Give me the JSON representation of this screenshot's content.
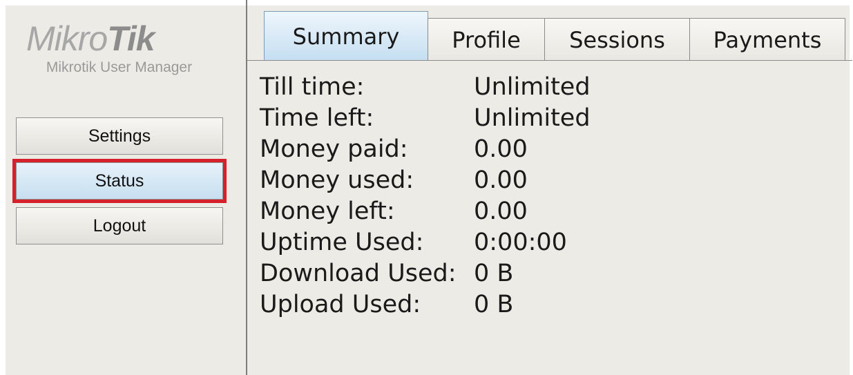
{
  "logo": {
    "mikro": "Mikro",
    "tik": "Tik"
  },
  "app_subtitle": "Mikrotik User Manager",
  "sidebar": {
    "buttons": [
      {
        "label": "Settings"
      },
      {
        "label": "Status"
      },
      {
        "label": "Logout"
      }
    ],
    "active": "Status",
    "highlight_color": "#d6202b"
  },
  "tabs": [
    {
      "label": "Summary"
    },
    {
      "label": "Profile"
    },
    {
      "label": "Sessions"
    },
    {
      "label": "Payments"
    }
  ],
  "active_tab": "Summary",
  "summary": [
    {
      "key": "Till time:",
      "value": "Unlimited"
    },
    {
      "key": "Time left:",
      "value": "Unlimited"
    },
    {
      "key": "Money paid:",
      "value": "0.00"
    },
    {
      "key": "Money used:",
      "value": "0.00"
    },
    {
      "key": "Money left:",
      "value": "0.00"
    },
    {
      "key": "Uptime Used:",
      "value": "0:00:00"
    },
    {
      "key": "Download Used:",
      "value": "0 B"
    },
    {
      "key": "Upload Used:",
      "value": "0 B"
    }
  ]
}
